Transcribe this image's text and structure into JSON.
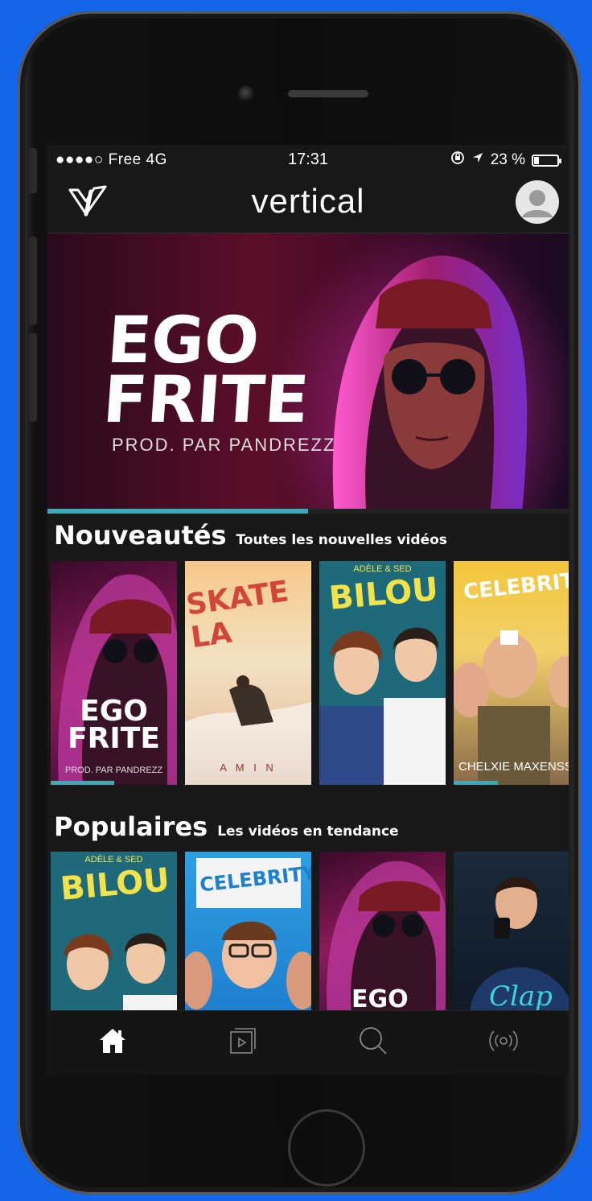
{
  "status_bar": {
    "carrier": "●●●●○ Free  4G",
    "time": "17:31",
    "battery": "23 %",
    "battery_level": 0.23
  },
  "navbar": {
    "brand": "vertical",
    "logo_icon": "vertical-logo-icon",
    "avatar_icon": "user-avatar-icon"
  },
  "hero": {
    "title_line1": "EGO",
    "title_line2": "FRITE",
    "subtitle": "PROD. PAR PANDREZZ",
    "progress": 0.5
  },
  "nouveautes": {
    "title": "Nouveautés",
    "subtitle": "Toutes les nouvelles vidéos",
    "cards": [
      {
        "title": "EGO FRITE",
        "caption": "PROD. PAR PANDREZZ",
        "progress": 0.5
      },
      {
        "title": "SKATE LA",
        "caption": "A M I N",
        "progress": 0
      },
      {
        "title": "BILOU",
        "caption": "ADÈLE & SED",
        "progress": 0
      },
      {
        "title": "CELEBRITY",
        "caption": "CHELXIE MAXENSS SE",
        "progress": 0.35
      }
    ]
  },
  "populaires": {
    "title": "Populaires",
    "subtitle": "Les vidéos en tendance",
    "cards": [
      {
        "title": "BILOU",
        "caption": "ADÈLE & SED"
      },
      {
        "title": "CELEBRITY",
        "caption": ""
      },
      {
        "title": "EGO",
        "caption": ""
      },
      {
        "title": "Clap",
        "caption": ""
      }
    ]
  },
  "tabbar": {
    "tabs": [
      {
        "icon": "home-icon",
        "active": true
      },
      {
        "icon": "video-library-icon",
        "active": false
      },
      {
        "icon": "search-icon",
        "active": false
      },
      {
        "icon": "live-broadcast-icon",
        "active": false
      }
    ]
  }
}
